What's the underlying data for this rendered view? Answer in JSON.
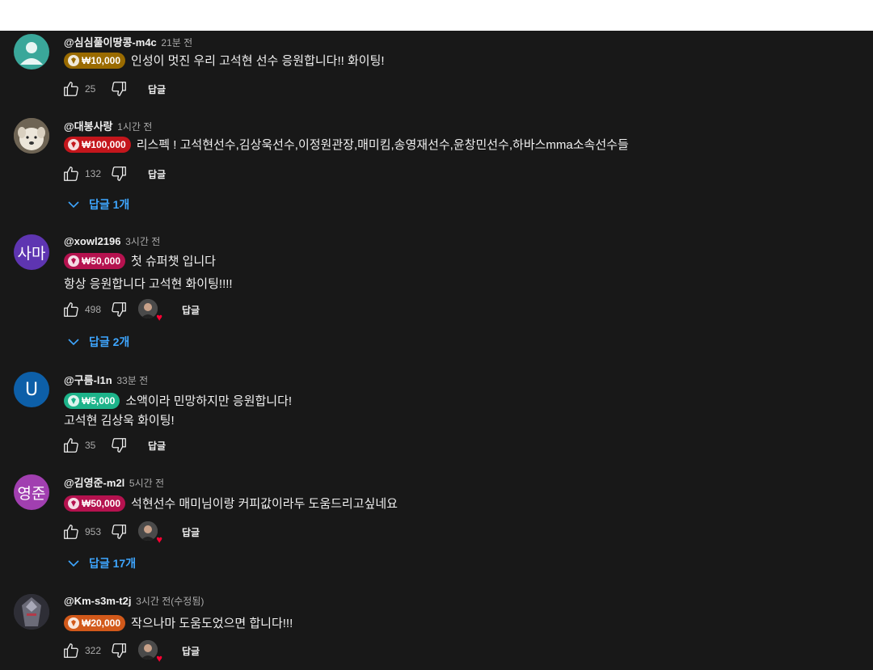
{
  "comments": [
    {
      "author": "@심심풀이땅콩-m4c",
      "time": "21분 전",
      "amount": "₩10,000",
      "chip_color": "#9a6b00",
      "text1": "인성이 멋진 우리 고석현 선수 응원합니다!! 화이팅!",
      "text2": "",
      "likes": "25",
      "reply_label": "답글",
      "avatar_type": "default-person"
    },
    {
      "author": "@대봉사랑",
      "time": "1시간 전",
      "amount": "₩100,000",
      "chip_color": "#c4161c",
      "text1": "리스펙 ! 고석현선수,김상욱선수,이정원관장,매미킴,송영재선수,윤창민선수,하바스mma소속선수들",
      "text2": "",
      "likes": "132",
      "reply_label": "답글",
      "replies_toggle": "답글 1개",
      "avatar_type": "dog-photo"
    },
    {
      "author": "@xowl2196",
      "time": "3시간 전",
      "amount": "₩50,000",
      "chip_color": "#b5124f",
      "text1": "첫 슈퍼챗 입니다",
      "text2": "항상 응원합니다 고석현 화이팅!!!!",
      "likes": "498",
      "reply_label": "답글",
      "replies_toggle": "답글 2개",
      "avatar_type": "initials",
      "initials": "사마",
      "avatar_color": "#5e35b1"
    },
    {
      "author": "@구름-l1n",
      "time": "33분 전",
      "amount": "₩5,000",
      "chip_color": "#1db38a",
      "text1": "소액이라 민망하지만 응원합니다!",
      "text2": "고석현 김상욱 화이팅!",
      "likes": "35",
      "reply_label": "답글",
      "avatar_type": "initials",
      "initials": "U",
      "avatar_color": "#0d5fa8"
    },
    {
      "author": "@김영준-m2l",
      "time": "5시간 전",
      "amount": "₩50,000",
      "chip_color": "#b5124f",
      "text1": "석현선수 매미님이랑 커피값이라두 도움드리고싶네요",
      "text2": "",
      "likes": "953",
      "reply_label": "답글",
      "replies_toggle": "답글 17개",
      "avatar_type": "initials",
      "initials": "영준",
      "avatar_color": "#a13fb0"
    },
    {
      "author": "@Km-s3m-t2j",
      "time": "3시간 전(수정됨)",
      "amount": "₩20,000",
      "chip_color": "#d2591a",
      "text1": "작으나마 도움도었으면 합니다!!!",
      "text2": "",
      "likes": "322",
      "reply_label": "답글",
      "avatar_type": "armor-photo"
    }
  ],
  "icons": {
    "like": "thumbs-up-icon",
    "dislike": "thumbs-down-icon",
    "creator_heart": "heart-icon",
    "expand": "chevron-down-icon",
    "superchat": "superchat-coin-icon"
  }
}
